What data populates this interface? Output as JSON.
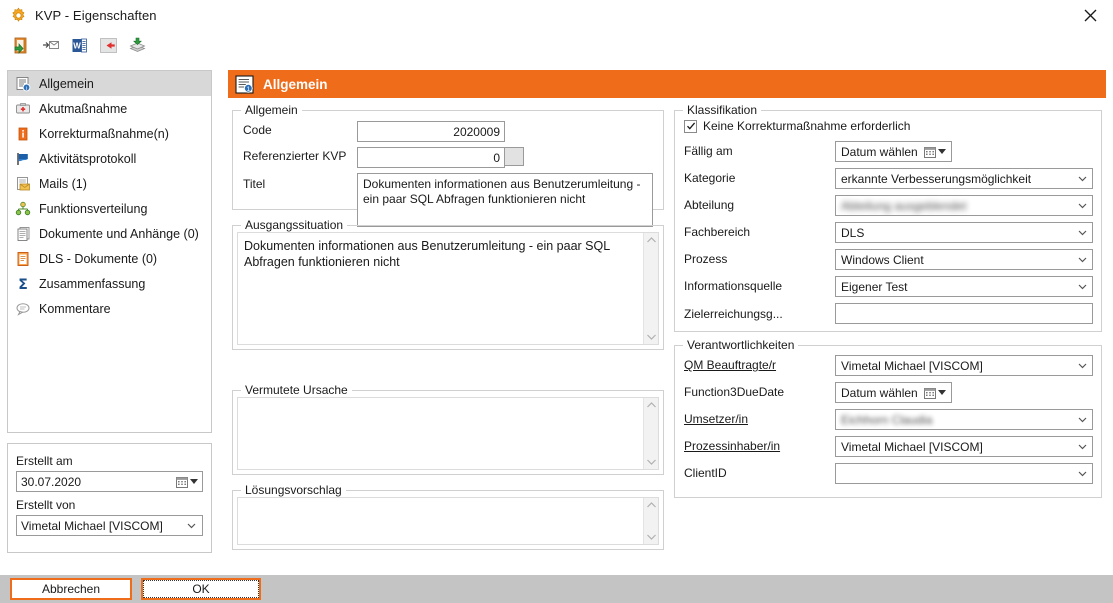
{
  "window": {
    "title": "KVP - Eigenschaften",
    "app_icon": "gear-icon",
    "close_label": "×"
  },
  "toolbar": {
    "buttons": [
      {
        "name": "save-and-close-icon",
        "tooltip": "Speichern und schließen"
      },
      {
        "name": "send-mail-icon",
        "tooltip": "Als Mail senden"
      },
      {
        "name": "word-export-icon",
        "tooltip": "Word Export"
      },
      {
        "name": "back-arrow-icon",
        "tooltip": "Zurück"
      },
      {
        "name": "publish-icon",
        "tooltip": "Veröffentlichen"
      }
    ]
  },
  "sidebar": {
    "items": [
      {
        "label": "Allgemein",
        "icon": "document-info-icon",
        "selected": true
      },
      {
        "label": "Akutmaßnahme",
        "icon": "first-aid-icon",
        "selected": false
      },
      {
        "label": "Korrekturmaßnahme(n)",
        "icon": "info-orange-icon",
        "selected": false
      },
      {
        "label": "Aktivitätsprotokoll",
        "icon": "flag-icon",
        "selected": false
      },
      {
        "label": "Mails (1)",
        "icon": "mail-document-icon",
        "selected": false
      },
      {
        "label": "Funktionsverteilung",
        "icon": "org-chart-icon",
        "selected": false
      },
      {
        "label": "Dokumente und Anhänge (0)",
        "icon": "documents-stack-icon",
        "selected": false
      },
      {
        "label": "DLS - Dokumente (0)",
        "icon": "document-orange-icon",
        "selected": false
      },
      {
        "label": "Zusammenfassung",
        "icon": "sigma-icon",
        "selected": false
      },
      {
        "label": "Kommentare",
        "icon": "comment-bubble-icon",
        "selected": false
      }
    ]
  },
  "meta": {
    "created_on_label": "Erstellt am",
    "created_on_value": "30.07.2020",
    "created_by_label": "Erstellt von",
    "created_by_value": "Vimetal Michael [VISCOM]"
  },
  "section": {
    "title": "Allgemein",
    "icon": "document-info-icon"
  },
  "allgemein": {
    "legend": "Allgemein",
    "code_label": "Code",
    "code_value": "2020009",
    "referenced_label": "Referenzierter KVP",
    "referenced_value": "0",
    "title_label": "Titel",
    "title_value": "Dokumenten informationen aus Benutzerumleitung - ein paar SQL Abfragen funktionieren nicht"
  },
  "ausgangssituation": {
    "legend": "Ausgangssituation",
    "value": "Dokumenten informationen aus Benutzerumleitung - ein paar SQL Abfragen funktionieren nicht"
  },
  "vermutete_ursache": {
    "legend": "Vermutete Ursache",
    "value": ""
  },
  "loesungsvorschlag": {
    "legend": "Lösungsvorschlag",
    "value": ""
  },
  "klassifikation": {
    "legend": "Klassifikation",
    "no_corrective_action_label": "Keine Korrekturmaßnahme erforderlich",
    "no_corrective_action_checked": true,
    "rows": [
      {
        "label": "Fällig am",
        "value": "Datum wählen",
        "control": "datepicker"
      },
      {
        "label": "Kategorie",
        "value": "erkannte Verbesserungsmöglichkeit",
        "control": "combobox"
      },
      {
        "label": "Abteilung",
        "value": "Abteilung ausgeblendet",
        "control": "combobox",
        "redacted": true
      },
      {
        "label": "Fachbereich",
        "value": "DLS",
        "control": "combobox"
      },
      {
        "label": "Prozess",
        "value": "Windows Client",
        "control": "combobox"
      },
      {
        "label": "Informationsquelle",
        "value": "Eigener Test",
        "control": "combobox"
      },
      {
        "label": "Zielerreichungsg...",
        "value": "",
        "control": "textbox"
      }
    ]
  },
  "verantwortlichkeiten": {
    "legend": "Verantwortlichkeiten",
    "rows": [
      {
        "label": "QM Beauftragte/r",
        "value": "Vimetal Michael [VISCOM]",
        "control": "combobox",
        "link": true
      },
      {
        "label": "Function3DueDate",
        "value": "Datum wählen",
        "control": "datepicker",
        "link": false
      },
      {
        "label": "Umsetzer/in",
        "value": "Eichhorn Claudia",
        "control": "combobox",
        "link": true,
        "redacted": true
      },
      {
        "label": "Prozessinhaber/in",
        "value": "Vimetal Michael [VISCOM]",
        "control": "combobox",
        "link": true
      },
      {
        "label": "ClientID",
        "value": "",
        "control": "combobox",
        "link": false
      }
    ]
  },
  "footer": {
    "cancel_label": "Abbrechen",
    "ok_label": "OK"
  },
  "colors": {
    "accent_orange": "#ef6c1a",
    "footer_gray": "#c4c4c4",
    "selection_gray": "#d8d8d8",
    "border_gray": "#9a9a9a"
  }
}
